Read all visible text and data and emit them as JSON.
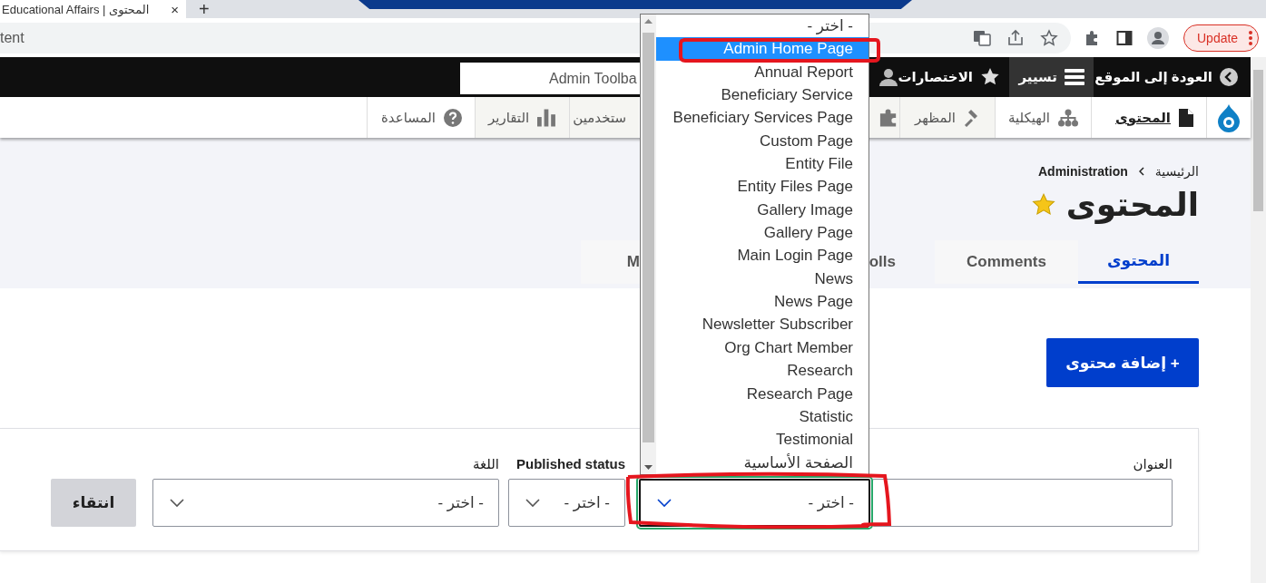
{
  "browser": {
    "tab": {
      "title": "Educational Affairs | المحتوى",
      "close": "×"
    },
    "new_tab": "+",
    "address": "tent",
    "update_button": "Update"
  },
  "admin_toolbar": {
    "items": [
      {
        "label": "العودة إلى الموقع",
        "selected": false
      },
      {
        "label": "تسيير",
        "selected": true
      },
      {
        "label": "الاختصارات",
        "selected": false
      }
    ],
    "search": {
      "value": "Admin Toolba"
    }
  },
  "tray": {
    "items": [
      {
        "kind": "link",
        "label": "المحتوى",
        "selected": true
      },
      {
        "kind": "link",
        "label": "الهيكلية",
        "selected": false
      },
      {
        "kind": "link",
        "label": "المظهر",
        "selected": false
      },
      {
        "kind": "icon_only",
        "selected": false
      },
      {
        "kind": "link",
        "label": "ستخدمين",
        "selected": false
      },
      {
        "kind": "link",
        "label": "التقارير",
        "selected": false
      },
      {
        "kind": "link",
        "label": "المساعدة",
        "selected": false
      }
    ]
  },
  "header": {
    "breadcrumb": [
      "الرئيسية",
      "Administration"
    ],
    "title": "المحتوى",
    "starred": true,
    "tabs": [
      {
        "label": "المحتوى",
        "selected": true
      },
      {
        "label": "Comments",
        "selected": false
      },
      {
        "label": "olls",
        "selected": false
      },
      {
        "label": "M",
        "selected": false
      }
    ]
  },
  "add_button": "+ إضافة محتوى",
  "filters": {
    "fields": [
      {
        "kind": "text",
        "label": "العنوان"
      },
      {
        "kind": "select",
        "value": "- اختر -",
        "focused": true
      },
      {
        "kind": "select",
        "label": "Published status",
        "value": "- اختر -",
        "focused": false
      },
      {
        "kind": "select",
        "label": "اللغة",
        "value": "- اختر -",
        "focused": false
      }
    ],
    "apply_button": "انتقاء"
  },
  "dropdown": {
    "open": true,
    "options": [
      {
        "label": "- اختر -",
        "selected": false
      },
      {
        "label": "Admin Home Page",
        "selected": true
      },
      {
        "label": "Annual Report",
        "selected": false
      },
      {
        "label": "Beneficiary Service",
        "selected": false
      },
      {
        "label": "Beneficiary Services Page",
        "selected": false
      },
      {
        "label": "Custom Page",
        "selected": false
      },
      {
        "label": "Entity File",
        "selected": false
      },
      {
        "label": "Entity Files Page",
        "selected": false
      },
      {
        "label": "Gallery Image",
        "selected": false
      },
      {
        "label": "Gallery Page",
        "selected": false
      },
      {
        "label": "Main Login Page",
        "selected": false
      },
      {
        "label": "News",
        "selected": false
      },
      {
        "label": "News Page",
        "selected": false
      },
      {
        "label": "Newsletter Subscriber",
        "selected": false
      },
      {
        "label": "Org Chart Member",
        "selected": false
      },
      {
        "label": "Research",
        "selected": false
      },
      {
        "label": "Research Page",
        "selected": false
      },
      {
        "label": "Statistic",
        "selected": false
      },
      {
        "label": "Testimonial",
        "selected": false
      },
      {
        "label": "الصفحة الأساسية",
        "selected": false
      }
    ]
  }
}
